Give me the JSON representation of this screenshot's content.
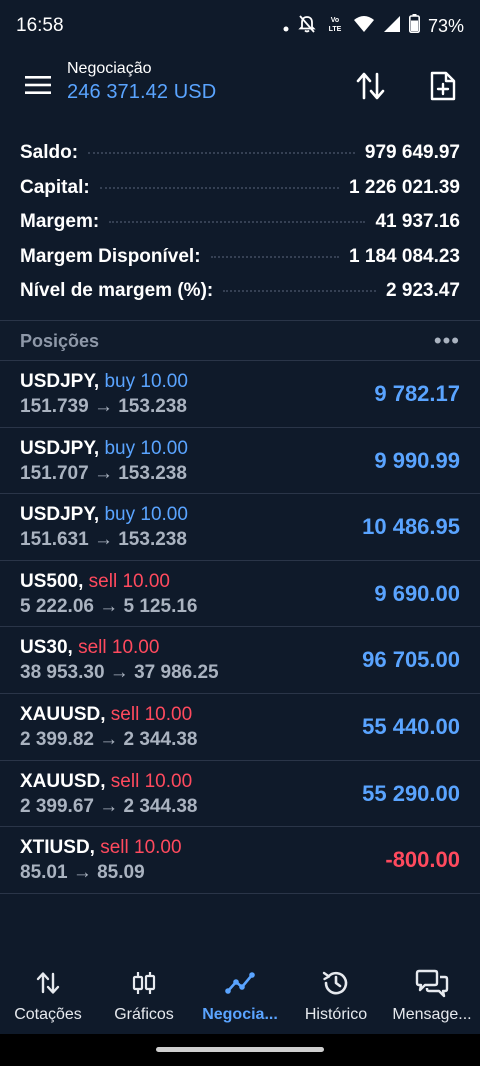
{
  "status": {
    "time": "16:58",
    "battery": "73%"
  },
  "header": {
    "title": "Negociação",
    "balance": "246 371.42 USD"
  },
  "summary": [
    {
      "label": "Saldo:",
      "value": "979 649.97"
    },
    {
      "label": "Capital:",
      "value": "1 226 021.39"
    },
    {
      "label": "Margem:",
      "value": "41 937.16"
    },
    {
      "label": "Margem Disponível:",
      "value": "1 184 084.23"
    },
    {
      "label": "Nível de margem (%):",
      "value": "2 923.47"
    }
  ],
  "section": {
    "title": "Posições",
    "more": "•••"
  },
  "positions": [
    {
      "symbol": "USDJPY,",
      "side": "buy 10.00",
      "prices": "151.739 → 153.238",
      "profit": "9 782.17"
    },
    {
      "symbol": "USDJPY,",
      "side": "buy 10.00",
      "prices": "151.707 → 153.238",
      "profit": "9 990.99"
    },
    {
      "symbol": "USDJPY,",
      "side": "buy 10.00",
      "prices": "151.631 → 153.238",
      "profit": "10 486.95"
    },
    {
      "symbol": "US500,",
      "side": "sell 10.00",
      "prices": "5 222.06 → 5 125.16",
      "profit": "9 690.00"
    },
    {
      "symbol": "US30,",
      "side": "sell 10.00",
      "prices": "38 953.30 → 37 986.25",
      "profit": "96 705.00"
    },
    {
      "symbol": "XAUUSD,",
      "side": "sell 10.00",
      "prices": "2 399.82 → 2 344.38",
      "profit": "55 440.00"
    },
    {
      "symbol": "XAUUSD,",
      "side": "sell 10.00",
      "prices": "2 399.67 → 2 344.38",
      "profit": "55 290.00"
    },
    {
      "symbol": "XTIUSD,",
      "side": "sell 10.00",
      "prices": "85.01 → 85.09",
      "profit": "-800.00"
    }
  ],
  "tabs": [
    {
      "label": "Cotações",
      "icon": "quotes-icon"
    },
    {
      "label": "Gráficos",
      "icon": "charts-icon"
    },
    {
      "label": "Negocia...",
      "icon": "trade-icon"
    },
    {
      "label": "Histórico",
      "icon": "history-icon"
    },
    {
      "label": "Mensage...",
      "icon": "messages-icon"
    }
  ],
  "colors": {
    "background": "#0f1a2a",
    "accent": "#5aa4ff",
    "negative": "#ff4a5e"
  }
}
